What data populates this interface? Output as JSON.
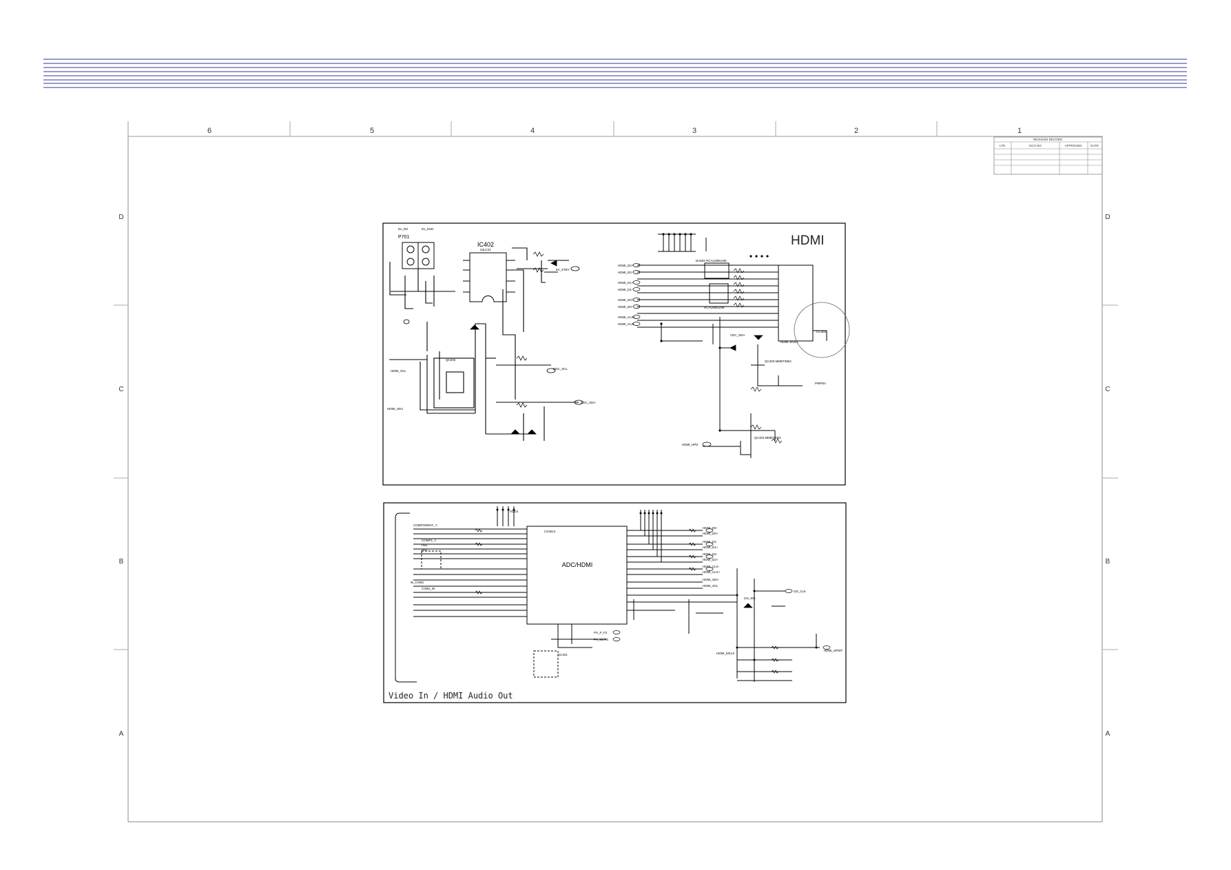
{
  "zones": {
    "columns": [
      "6",
      "5",
      "4",
      "3",
      "2",
      "1"
    ],
    "rows": [
      "D",
      "C",
      "B",
      "A"
    ]
  },
  "revision_block": {
    "title": "REVISION RECORD",
    "headers": [
      "LTR",
      "ECO NO",
      "APPROVED",
      "DATE"
    ]
  },
  "hdmi_panel": {
    "title": "HDMI",
    "ic_main": "IC402",
    "ic_main_part": "24LC21",
    "ic_bottom": "QC202",
    "connector": "P701",
    "connector_pins": [
      "5V_RS",
      "5V_ESD"
    ],
    "net_labels": [
      "HDMI_SCL",
      "HDMI_SDA",
      "DDC_SCL",
      "DDC_SDA",
      "HDMI_HPD",
      "5V_STBY",
      "HDMI_D2+",
      "HDMI_D2-",
      "HDMI_D1+",
      "HDMI_D1-",
      "HDMI_D0+",
      "HDMI_D0-",
      "HDMI_CLK+",
      "HDMI_CLK-",
      "CEC_SDA",
      "PWR5V"
    ],
    "array_top": "DA502 RCALM0514M",
    "array_bottom": "RCALM0514M",
    "hdmi_conn": "HDMI JP301",
    "transistors": [
      "QC403 MMBT3904",
      "QC402 MMBT3904"
    ],
    "circled_part": "CC303"
  },
  "video_panel": {
    "title": "Video In / HDMI Audio Out",
    "ic_main": "ADC/HDMI",
    "ic_part": "CX3514",
    "vdd_label": "VDD3",
    "left_nets": [
      "COMPONENT_Y",
      "COMP1_Y",
      "PB1",
      "PR1",
      "W_CVBS",
      "CVBS_IN"
    ],
    "right_nets": [
      "HDMI_D0-",
      "HDMI_D0+",
      "HDMI_D1-",
      "HDMI_D1+",
      "HDMI_D2-",
      "HDMI_D2+",
      "HDMI_CLK-",
      "HDMI_CLK+",
      "HDMI_SDA",
      "HDMI_SCL",
      "HDMI_SPDIF",
      "I2S_CLK",
      "I2S_WS",
      "HDMI_MCLK"
    ],
    "crystal": "XC401",
    "bottom_nets": [
      "PX_P_F2",
      "PX_MUTE"
    ]
  }
}
